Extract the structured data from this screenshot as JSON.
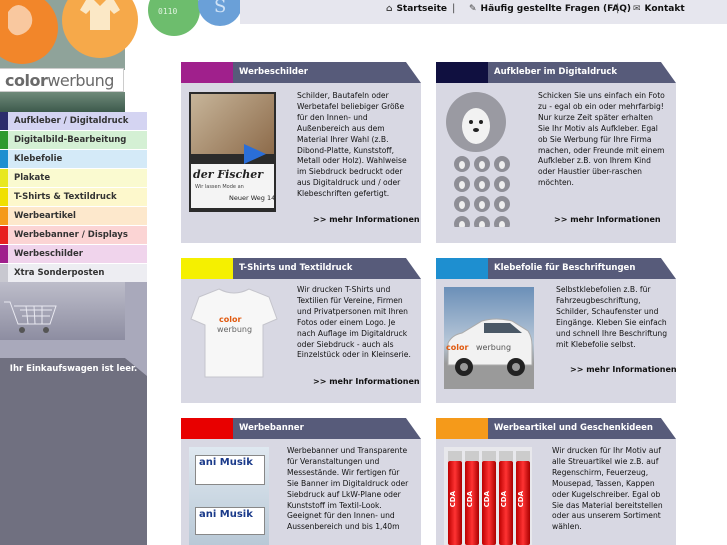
{
  "topnav": {
    "home": "Startseite",
    "faq": "Häufig gestellte Fragen (FAQ)",
    "contact": "Kontakt",
    "separator": "|"
  },
  "logo": {
    "color": "color",
    "werbung": "werbung"
  },
  "menu": {
    "items": [
      {
        "label": "Aufkleber / Digitaldruck",
        "color": "#2c2c6c",
        "bg": "#d4d4f2"
      },
      {
        "label": "Digitalbild-Bearbeitung",
        "color": "#2e9a2e",
        "bg": "#d4f0d4"
      },
      {
        "label": "Klebefolie",
        "color": "#1e8fd0",
        "bg": "#d4eaf8"
      },
      {
        "label": "Plakate",
        "color": "#e8e820",
        "bg": "#fafad0"
      },
      {
        "label": "T-Shirts & Textildruck",
        "color": "#f0e000",
        "bg": "#fdf8cc"
      },
      {
        "label": "Werbeartikel",
        "color": "#f59a1a",
        "bg": "#fde8cc"
      },
      {
        "label": "Werbebanner / Displays",
        "color": "#e82020",
        "bg": "#fbd4d4"
      },
      {
        "label": "Werbeschilder",
        "color": "#a0208c",
        "bg": "#f0d4ec"
      },
      {
        "label": "Xtra Sonderposten",
        "color": "#c8c8d0",
        "bg": "#ededf2"
      }
    ]
  },
  "cart": {
    "text": "Ihr Einkaufswagen ist leer."
  },
  "cards": {
    "werbeschilder": {
      "title": "Werbeschilder",
      "swatch": "#a0208c",
      "text": "Schilder, Bautafeln oder Werbetafel beliebiger Größe für den Innen- und Außenbereich aus dem Material Ihrer Wahl (z.B. Dibond-Platte, Kunststoff, Metall oder Holz). Wahlweise im Siebdruck bedruckt oder aus Digitaldruck und / oder Klebeschriften gefertigt.",
      "more": ">> mehr Informationen",
      "sign_name": "der Fischer",
      "sign_sub": "Wir lassen Mode an",
      "sign_addr": "Neuer Weg 14"
    },
    "aufkleber": {
      "title": "Aufkleber im Digitaldruck",
      "swatch": "#101040",
      "text": "Schicken Sie uns einfach ein Foto zu - egal ob ein oder mehrfarbig! Nur kurze Zeit später erhalten Sie Ihr Motiv als Aufkleber. Egal ob Sie Werbung für Ihre Firma machen, oder Freunde mit einem Aufkleber z.B. von Ihrem Kind oder Haustier über-raschen möchten.",
      "more": ">> mehr Informationen"
    },
    "tshirts": {
      "title": "T-Shirts und Textildruck",
      "swatch": "#f5f000",
      "text": "Wir drucken T-Shirts und Textilien für Vereine, Firmen und Privatpersonen mit Ihren Fotos oder einem Logo. Je nach Auflage im Digitaldruck oder Siebdruck - auch als Einzelstück oder in Kleinserie.",
      "more": ">> mehr Informationen",
      "shirt_color": "color",
      "shirt_werbung": "werbung"
    },
    "klebefolie": {
      "title": "Klebefolie für Beschriftungen",
      "swatch": "#1e8fd0",
      "text": "Selbstklebefolien z.B. für Fahrzeugbeschriftung, Schilder, Schaufenster und Eingänge. Kleben Sie einfach und schnell Ihre Beschriftung mit Klebefolie selbst.",
      "more": ">> mehr Informationen",
      "car_color": "color",
      "car_werbung": "werbung"
    },
    "werbebanner": {
      "title": "Werbebanner",
      "swatch": "#e80000",
      "text": "Werbebanner und Transparente für Veranstaltungen und Messestände. Wir fertigen für Sie Banner im Digitaldruck oder Siebdruck auf LkW-Plane oder Kunststoff im Textil-Look. Geeignet für den Innen- und Aussenbereich und bis 1,40m",
      "banner1": "ani Musik",
      "banner2": "ani Musik"
    },
    "werbeartikel": {
      "title": "Werbeartikel und Geschenkideen",
      "swatch": "#f59a1a",
      "text": "Wir drucken für Ihr Motiv auf alle Streuartikel wie z.B. auf Regenschirm, Feuerzeug, Mousepad, Tassen, Kappen oder Kugelschreiber. Egal ob Sie das Material bereitstellen oder aus unserem Sortiment wählen.",
      "lighter_label": "CDA"
    }
  }
}
